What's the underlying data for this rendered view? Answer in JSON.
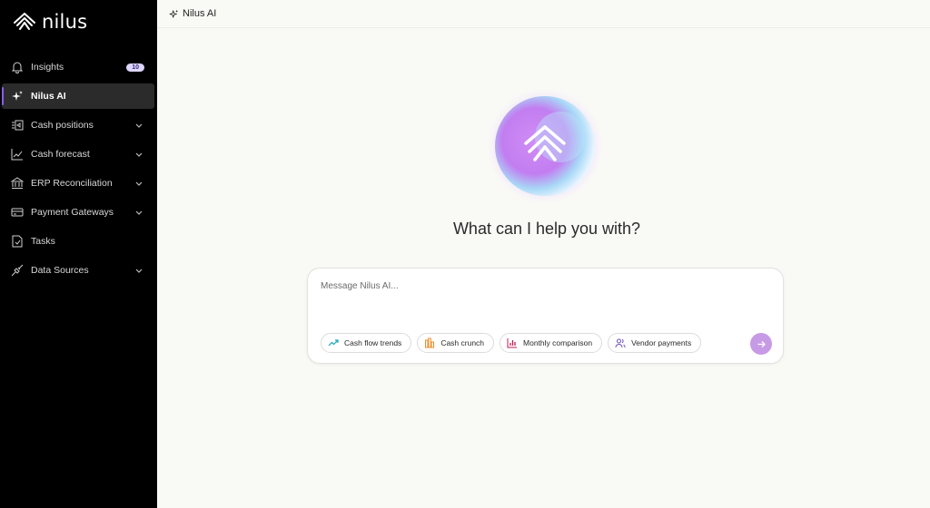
{
  "brand": {
    "name": "nilus"
  },
  "topbar": {
    "title": "Nilus AI"
  },
  "sidebar": {
    "items": [
      {
        "label": "Insights",
        "badge": "10"
      },
      {
        "label": "Nilus AI"
      },
      {
        "label": "Cash positions"
      },
      {
        "label": "Cash forecast"
      },
      {
        "label": "ERP Reconciliation"
      },
      {
        "label": "Payment Gateways"
      },
      {
        "label": "Tasks"
      },
      {
        "label": "Data Sources"
      }
    ]
  },
  "main": {
    "prompt": "What can I help you with?",
    "input_placeholder": "Message Nilus AI...",
    "chips": [
      {
        "label": "Cash flow trends"
      },
      {
        "label": "Cash crunch"
      },
      {
        "label": "Monthly comparison"
      },
      {
        "label": "Vendor payments"
      }
    ]
  },
  "colors": {
    "sidebar_bg": "#000000",
    "accent": "#8b5cf6",
    "send_button": "#c79ae6",
    "page_bg": "#f9f9f6"
  }
}
